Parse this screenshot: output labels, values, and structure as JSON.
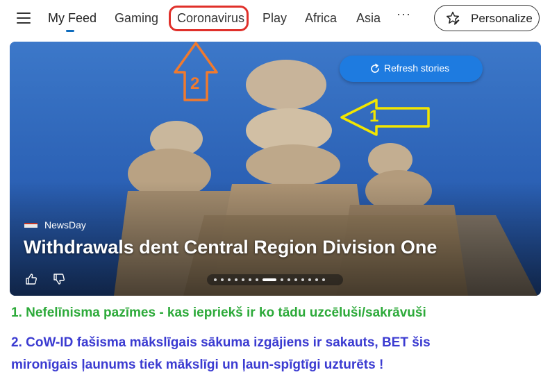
{
  "nav": {
    "menu_icon": "hamburger-menu-icon",
    "tabs": [
      {
        "label": "My Feed",
        "active": true
      },
      {
        "label": "Gaming"
      },
      {
        "label": "Coronavirus"
      },
      {
        "label": "Play"
      },
      {
        "label": "Africa"
      },
      {
        "label": "Asia"
      }
    ],
    "more_label": "···",
    "personalize_label": "Personalize",
    "personalize_icon": "star-edit-icon"
  },
  "hero": {
    "refresh_label": "Refresh stories",
    "refresh_icon": "refresh-icon",
    "source_name": "NewsDay",
    "headline": "Withdrawals dent Central Region Division One",
    "like_icon": "thumbs-up-icon",
    "dislike_icon": "thumbs-down-icon",
    "carousel_dot_count": 15,
    "carousel_active_index": 7
  },
  "annotations": {
    "arrow1_label": "1",
    "arrow2_label": "2",
    "arrow1_color": "#f2e600",
    "arrow2_color": "#f07a2e",
    "highlight_color": "#e0302a",
    "line1": "1. Nefelīnisma pazīmes - kas iepriekš ir ko tādu uzcēluši/sakrāvuši",
    "line2": "2. CoW-ID fašisma mākslīgais sākuma izgājiens ir sakauts, BET šis",
    "line3": "mironīgais ļaunums tiek mākslīgi un ļaun-spīgtīgi uzturēts !"
  }
}
